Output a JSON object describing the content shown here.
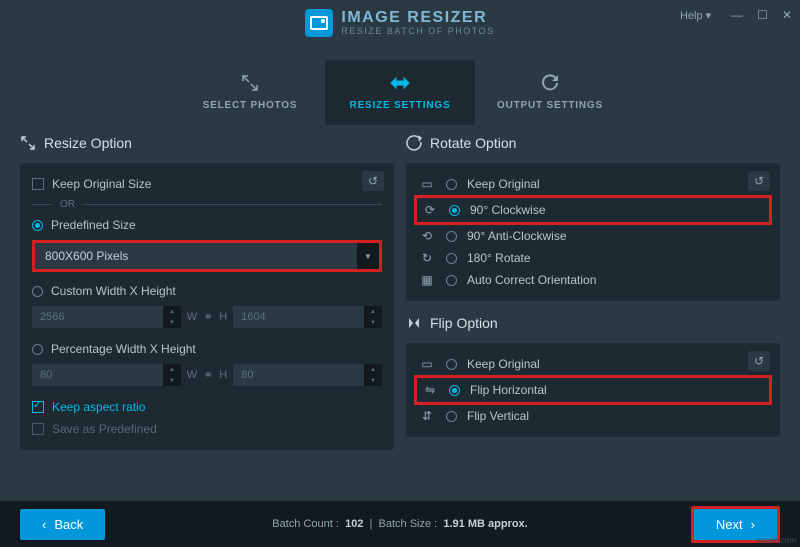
{
  "app": {
    "title": "IMAGE RESIZER",
    "subtitle": "RESIZE BATCH OF PHOTOS"
  },
  "window": {
    "help": "Help ▾",
    "min": "—",
    "max": "☐",
    "close": "✕"
  },
  "tabs": {
    "select": "SELECT PHOTOS",
    "resize": "RESIZE SETTINGS",
    "output": "OUTPUT SETTINGS"
  },
  "resize": {
    "header": "Resize Option",
    "keep_original": "Keep Original Size",
    "or": "OR",
    "predefined": "Predefined Size",
    "predefined_value": "800X600 Pixels",
    "custom": "Custom Width X Height",
    "custom_w": "2566",
    "custom_h": "1604",
    "w": "W",
    "h": "H",
    "percentage": "Percentage Width X Height",
    "pct_w": "80",
    "pct_h": "80",
    "keep_aspect": "Keep aspect ratio",
    "save_predef": "Save as Predefined"
  },
  "rotate": {
    "header": "Rotate Option",
    "keep": "Keep Original",
    "cw90": "90° Clockwise",
    "ccw90": "90° Anti-Clockwise",
    "r180": "180° Rotate",
    "auto": "Auto Correct Orientation"
  },
  "flip": {
    "header": "Flip Option",
    "keep": "Keep Original",
    "h": "Flip Horizontal",
    "v": "Flip Vertical"
  },
  "footer": {
    "back": "Back",
    "next": "Next",
    "batch_count_label": "Batch Count :",
    "batch_count": "102",
    "batch_size_label": "Batch Size :",
    "batch_size": "1.91 MB approx."
  },
  "watermark": "wsxdn.com"
}
